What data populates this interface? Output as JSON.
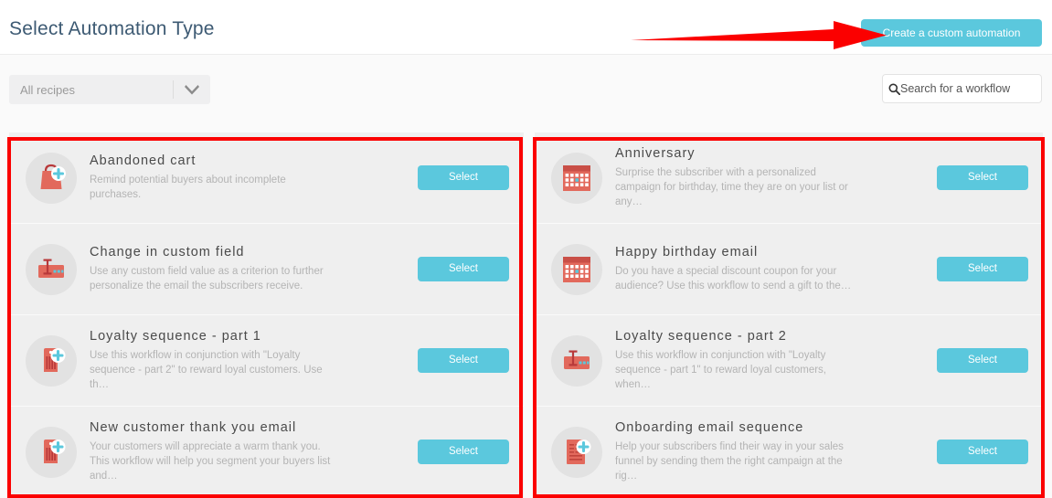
{
  "header": {
    "title": "Select Automation Type",
    "create_button": "Create a custom automation",
    "arrow_annotation": "red-arrow-pointing-to-create-button"
  },
  "filters": {
    "recipe_select_value": "All recipes",
    "chevron_icon": "chevron-down-icon",
    "search_icon": "search-icon",
    "search_value": "",
    "search_placeholder": "Search for a workflow"
  },
  "colors": {
    "accent": "#5bc8dd",
    "title": "#3d5a73",
    "icon_coral": "#e2695c",
    "icon_dark_red": "#c0443c",
    "annotation_red": "#fb0000",
    "card_bg": "#efefef",
    "page_bg": "#fafafa"
  },
  "columns": [
    {
      "name": "left-column",
      "cards": [
        {
          "icon": "shopping-bag-plus-icon",
          "title": "Abandoned cart",
          "description": "Remind potential buyers about incomplete purchases.",
          "button": "Select"
        },
        {
          "icon": "custom-field-icon",
          "title": "Change in custom field",
          "description": "Use any custom field value as a criterion to further personalize the email the subscribers receive.",
          "button": "Select"
        },
        {
          "icon": "loyalty-tag-plus-icon",
          "title": "Loyalty sequence - part 1",
          "description": "Use this workflow in conjunction with \"Loyalty sequence - part 2\" to reward loyal customers. Use th…",
          "button": "Select"
        },
        {
          "icon": "loyalty-tag-plus-icon",
          "title": "New customer thank you email",
          "description": "Your customers will appreciate a warm thank you. This workflow will help you segment your buyers list and…",
          "button": "Select"
        }
      ]
    },
    {
      "name": "right-column",
      "cards": [
        {
          "icon": "calendar-icon",
          "title": "Anniversary",
          "description": "Surprise the subscriber with a personalized campaign for birthday, time they are on your list or any…",
          "button": "Select"
        },
        {
          "icon": "calendar-icon",
          "title": "Happy birthday email",
          "description": "Do you have a special discount coupon for your audience? Use this workflow to send a gift to the…",
          "button": "Select"
        },
        {
          "icon": "custom-field-icon",
          "title": "Loyalty sequence - part 2",
          "description": "Use this workflow in conjunction with \"Loyalty sequence - part 1\" to reward loyal customers, when…",
          "button": "Select"
        },
        {
          "icon": "document-plus-icon",
          "title": "Onboarding email sequence",
          "description": "Help your subscribers find their way in your sales funnel by sending them the right campaign at the rig…",
          "button": "Select"
        }
      ]
    }
  ]
}
